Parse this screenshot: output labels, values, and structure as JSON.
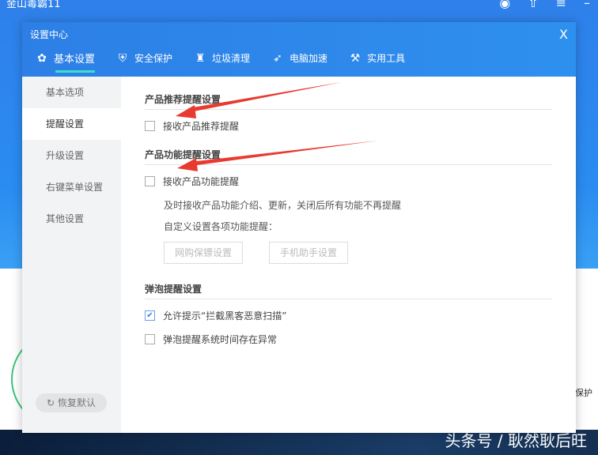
{
  "app": {
    "title": "金山毒霸11"
  },
  "background": {
    "side_label": "保护",
    "watermark": "头条号 / 耿然耿后旺"
  },
  "dialog": {
    "title": "设置中心",
    "close": "X",
    "tabs": [
      {
        "label": "基本设置",
        "icon": "gear-icon"
      },
      {
        "label": "安全保护",
        "icon": "shield-icon"
      },
      {
        "label": "垃圾清理",
        "icon": "broom-icon"
      },
      {
        "label": "电脑加速",
        "icon": "rocket-icon"
      },
      {
        "label": "实用工具",
        "icon": "wrench-icon"
      }
    ],
    "sidebar": [
      {
        "label": "基本选项"
      },
      {
        "label": "提醒设置"
      },
      {
        "label": "升级设置"
      },
      {
        "label": "右键菜单设置"
      },
      {
        "label": "其他设置"
      }
    ],
    "restore_label": "恢复默认",
    "sections": {
      "product_rec": {
        "title": "产品推荐提醒设置",
        "checkbox": "接收产品推荐提醒",
        "checked": false
      },
      "product_func": {
        "title": "产品功能提醒设置",
        "checkbox": "接收产品功能提醒",
        "checked": false,
        "desc": "及时接收产品功能介绍、更新，关闭后所有功能不再提醒",
        "custom": "自定义设置各项功能提醒：",
        "buttons": [
          "网购保镖设置",
          "手机助手设置"
        ]
      },
      "bubble": {
        "title": "弹泡提醒设置",
        "options": [
          {
            "label": "允许提示“拦截黑客恶意扫描”",
            "checked": true
          },
          {
            "label": "弹泡提醒系统时间存在异常",
            "checked": false
          }
        ]
      }
    }
  },
  "colors": {
    "accent": "#2d7fe6",
    "tab_underline": "#3de0c4",
    "arrow": "#e83a30"
  }
}
